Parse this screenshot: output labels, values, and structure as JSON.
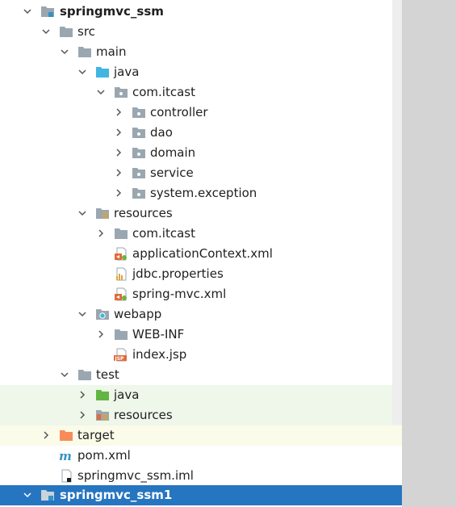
{
  "tree": {
    "project": {
      "name": "springmvc_ssm",
      "icon": "module-folder-icon"
    },
    "src": {
      "name": "src",
      "icon": "folder-icon"
    },
    "main": {
      "name": "main",
      "icon": "folder-icon"
    },
    "java": {
      "name": "java",
      "icon": "source-root-folder-icon"
    },
    "pkg": {
      "name": "com.itcast",
      "icon": "package-icon"
    },
    "controller": {
      "name": "controller",
      "icon": "package-icon"
    },
    "dao": {
      "name": "dao",
      "icon": "package-icon"
    },
    "domain": {
      "name": "domain",
      "icon": "package-icon"
    },
    "service": {
      "name": "service",
      "icon": "package-icon"
    },
    "system_exception": {
      "name": "system.exception",
      "icon": "package-icon"
    },
    "resources": {
      "name": "resources",
      "icon": "resources-root-folder-icon"
    },
    "res_pkg": {
      "name": "com.itcast",
      "icon": "package-icon"
    },
    "app_context": {
      "name": "applicationContext.xml",
      "icon": "spring-xml-file-icon"
    },
    "jdbc_props": {
      "name": "jdbc.properties",
      "icon": "properties-file-icon"
    },
    "spring_mvc": {
      "name": "spring-mvc.xml",
      "icon": "spring-xml-file-icon"
    },
    "webapp": {
      "name": "webapp",
      "icon": "web-folder-icon"
    },
    "web_inf": {
      "name": "WEB-INF",
      "icon": "folder-icon"
    },
    "index_jsp": {
      "name": "index.jsp",
      "icon": "jsp-file-icon"
    },
    "test": {
      "name": "test",
      "icon": "folder-icon"
    },
    "test_java": {
      "name": "java",
      "icon": "test-source-root-folder-icon"
    },
    "test_resources": {
      "name": "resources",
      "icon": "test-resources-root-folder-icon"
    },
    "target": {
      "name": "target",
      "icon": "excluded-folder-icon"
    },
    "pom": {
      "name": "pom.xml",
      "icon": "maven-file-icon"
    },
    "iml": {
      "name": "springmvc_ssm.iml",
      "icon": "iml-file-icon"
    },
    "project2": {
      "name": "springmvc_ssm1",
      "icon": "module-folder-icon",
      "selected": true
    }
  },
  "colors": {
    "selection": "#2675c0",
    "test_background": "#eff6ea",
    "excluded_background": "#fbfbe9",
    "folder": "#9aa7b0",
    "source_root": "#40b6e0",
    "test_root": "#62b543",
    "excluded": "#f98b5b"
  }
}
